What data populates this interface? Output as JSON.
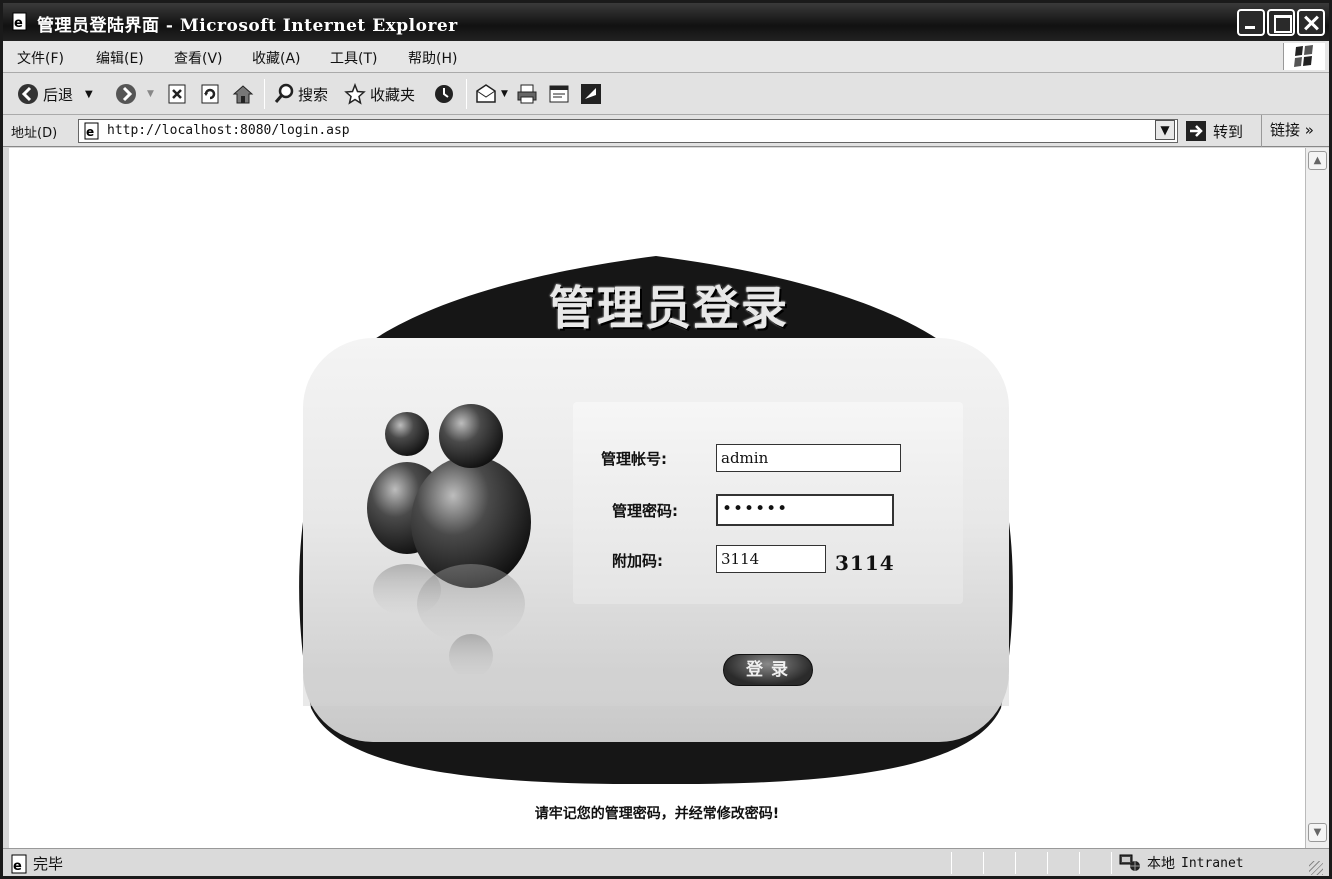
{
  "window": {
    "title": "管理员登陆界面 - Microsoft Internet Explorer"
  },
  "menubar": {
    "items": [
      {
        "label": "文件(F)"
      },
      {
        "label": "编辑(E)"
      },
      {
        "label": "查看(V)"
      },
      {
        "label": "收藏(A)"
      },
      {
        "label": "工具(T)"
      },
      {
        "label": "帮助(H)"
      }
    ]
  },
  "toolbar": {
    "back_label": "后退",
    "search_label": "搜索",
    "favorites_label": "收藏夹"
  },
  "addressbar": {
    "label": "地址(D)",
    "url": "http://localhost:8080/login.asp",
    "go_label": "转到",
    "links_label": "链接 »"
  },
  "login": {
    "title": "管理员登录",
    "account_label": "管理帐号:",
    "account_value": "admin",
    "password_label": "管理密码:",
    "password_value": "••••••",
    "code_label": "附加码:",
    "code_value": "3114",
    "captcha": "3114",
    "submit_label": "登录",
    "tip": "请牢记您的管理密码，并经常修改密码!"
  },
  "statusbar": {
    "status": "完毕",
    "zone_prefix": "本地",
    "zone_name": "Intranet"
  },
  "colors": {
    "panel_dark": "#161616",
    "panel_light": "#e6e6e6"
  }
}
